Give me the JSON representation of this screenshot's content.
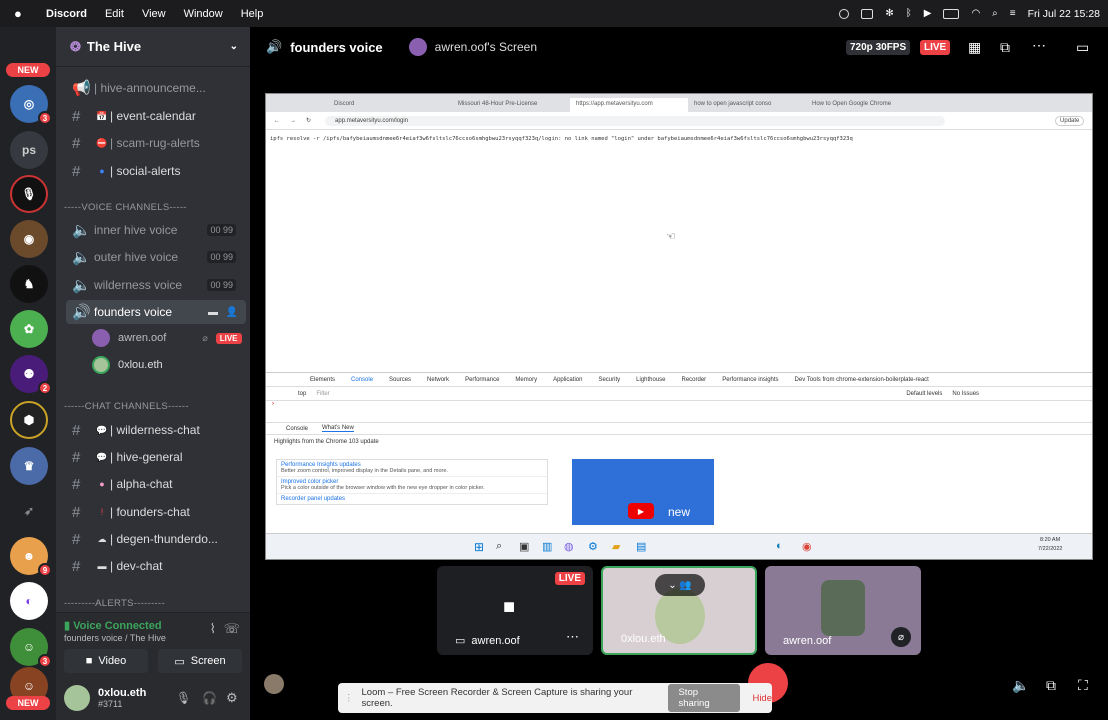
{
  "menubar": {
    "app": "Discord",
    "items": [
      "Edit",
      "View",
      "Window",
      "Help"
    ],
    "clock": "Fri Jul 22  15:28"
  },
  "guilds": {
    "new_top": "NEW",
    "new_bottom": "NEW",
    "ps": "ps",
    "badges": [
      "3",
      "2",
      "9",
      "3"
    ]
  },
  "server": {
    "name": "The Hive"
  },
  "channels": {
    "hive_announce": "| hive-announceme...",
    "event_calendar": "| event-calendar",
    "scam_rug": "| scam-rug-alerts",
    "social_alerts": "| social-alerts",
    "voice_cat": "-----VOICE CHANNELS-----",
    "inner_hive": "inner hive voice",
    "outer_hive": "outer hive voice",
    "wilderness": "wilderness voice",
    "founders": "founders voice",
    "count_a": "00",
    "count_b": "99",
    "chat_cat": "------CHAT CHANNELS------",
    "wilderness_chat": "| wilderness-chat",
    "hive_general": "| hive-general",
    "alpha_chat": "| alpha-chat",
    "founders_chat": "| founders-chat",
    "degen": "| degen-thunderdo...",
    "dev_chat": "| dev-chat",
    "alerts_cat": "---------ALERTS---------"
  },
  "voice_users": {
    "u1": "awren.oof",
    "u2": "0xlou.eth",
    "live": "LIVE"
  },
  "voice_connected": {
    "status": "Voice Connected",
    "sub": "founders voice / The Hive",
    "video": "Video",
    "screen": "Screen"
  },
  "userbar": {
    "name": "0xlou.eth",
    "tag": "#3711"
  },
  "topbar": {
    "channel": "founders voice",
    "stream": "awren.oof's Screen",
    "quality": "720p 30FPS",
    "live": "LIVE"
  },
  "browser": {
    "tabs": [
      "Discord",
      "Missouri 48-Hour Pre-License",
      "https://app.metaversityu.com",
      "how to open javascript conso",
      "How to Open Google Chrome"
    ],
    "url": "app.metaversityu.com/login",
    "update": "Update",
    "error": "ipfs resolve -r /ipfs/bafybeiaumsdnmee6r4eiaf3w6fsltslc76ccso6smhgbwu23rsyqqf323q/login: no link named \"login\" under bafybeiaumsdnmee6r4eiaf3w6fsltslc76ccso6smhgbwu23rsyqqf323q"
  },
  "devtools": {
    "tabs": [
      "Elements",
      "Console",
      "Sources",
      "Network",
      "Performance",
      "Memory",
      "Application",
      "Security",
      "Lighthouse",
      "Recorder",
      "Performance insights",
      "Dev Tools from chrome-extension-boilerplate-react"
    ],
    "context": "top",
    "filter": "Filter",
    "levels": "Default levels",
    "issues": "No Issues",
    "drawer_tabs": [
      "Console",
      "What's New"
    ],
    "highlights": "Highlights from the Chrome 103 update",
    "items": [
      {
        "title": "Performance Insights updates",
        "desc": "Better zoom control, improved display in the Details pane, and more."
      },
      {
        "title": "Improved color picker",
        "desc": "Pick a color outside of the browser window with the new eye dropper in color picker."
      },
      {
        "title": "Recorder panel updates",
        "desc": ""
      }
    ],
    "video_label": "new",
    "time": "8:20 AM",
    "date": "7/22/2022"
  },
  "tiles": {
    "t1": "awren.oof",
    "t1_live": "LIVE",
    "t2": "0xlou.eth",
    "t3": "awren.oof"
  },
  "loom": {
    "text": "Loom – Free Screen Recorder & Screen Capture is sharing your screen.",
    "stop": "Stop sharing",
    "hide": "Hide"
  }
}
